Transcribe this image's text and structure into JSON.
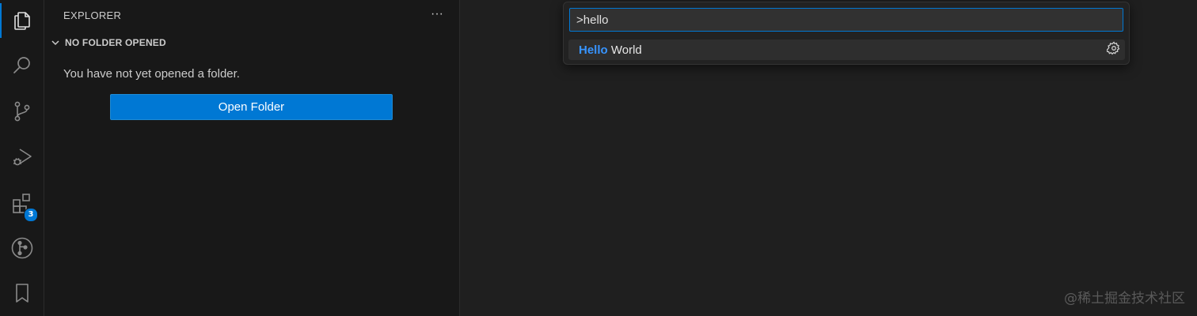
{
  "activity_bar": {
    "items": [
      {
        "id": "explorer",
        "icon": "files-icon",
        "active": true
      },
      {
        "id": "search",
        "icon": "search-icon"
      },
      {
        "id": "source-control",
        "icon": "source-control-icon"
      },
      {
        "id": "run-debug",
        "icon": "run-debug-icon"
      },
      {
        "id": "extensions",
        "icon": "extensions-icon",
        "badge": "3"
      },
      {
        "id": "git-graph",
        "icon": "git-graph-icon"
      },
      {
        "id": "bookmarks",
        "icon": "bookmark-icon"
      }
    ],
    "accent_color": "#0078d4"
  },
  "sidebar": {
    "title": "EXPLORER",
    "more_actions": "···",
    "section": {
      "title": "NO FOLDER OPENED",
      "message": "You have not yet opened a folder.",
      "button_label": "Open Folder"
    }
  },
  "command_palette": {
    "input_value": ">hello",
    "results": [
      {
        "highlight": "Hello",
        "rest": " World",
        "action_icon": "gear-icon"
      }
    ],
    "highlight_color": "#3794ff"
  },
  "watermark": "@稀土掘金技术社区"
}
